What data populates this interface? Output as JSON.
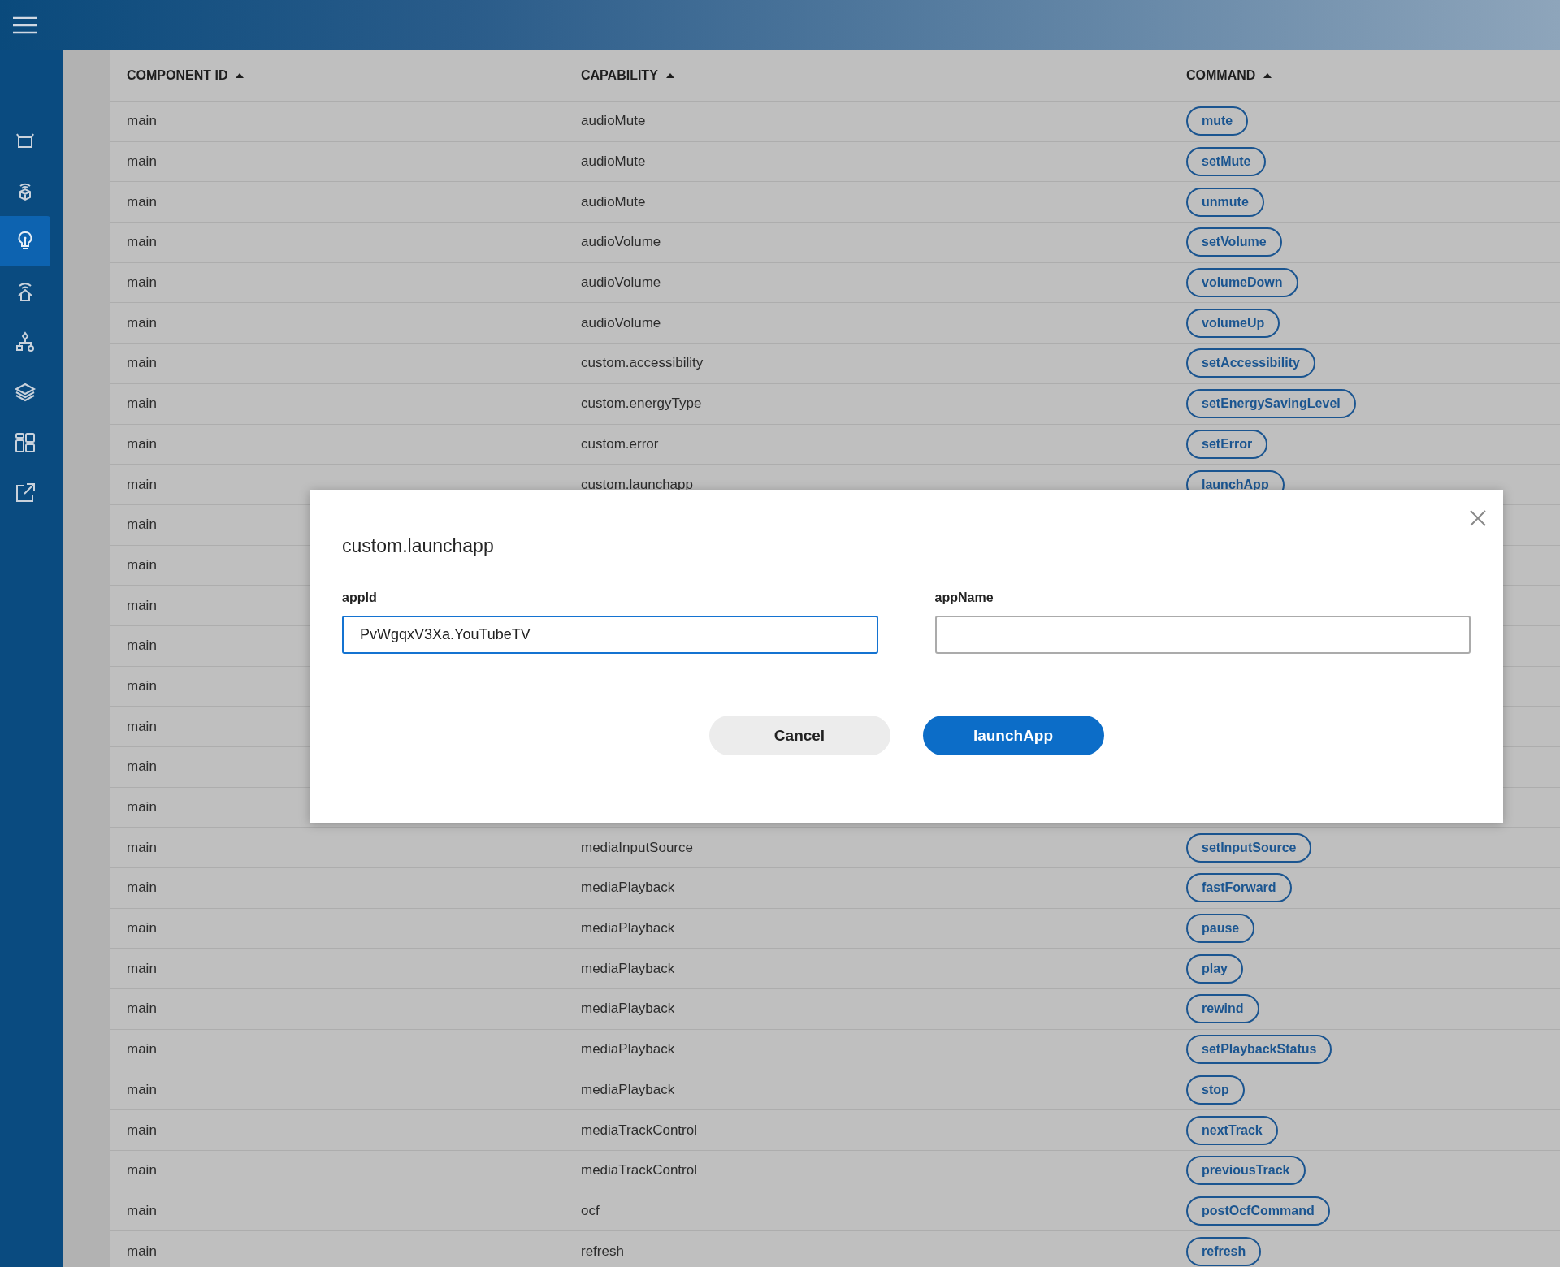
{
  "sidebar": {
    "items": [
      {
        "selected": false
      },
      {
        "selected": false
      },
      {
        "selected": true
      },
      {
        "selected": false
      },
      {
        "selected": false
      },
      {
        "selected": false
      },
      {
        "selected": false
      },
      {
        "selected": false
      }
    ]
  },
  "table": {
    "columns": [
      "COMPONENT ID",
      "CAPABILITY",
      "COMMAND"
    ],
    "rows": [
      {
        "component": "main",
        "capability": "audioMute",
        "command": "mute"
      },
      {
        "component": "main",
        "capability": "audioMute",
        "command": "setMute"
      },
      {
        "component": "main",
        "capability": "audioMute",
        "command": "unmute"
      },
      {
        "component": "main",
        "capability": "audioVolume",
        "command": "setVolume"
      },
      {
        "component": "main",
        "capability": "audioVolume",
        "command": "volumeDown"
      },
      {
        "component": "main",
        "capability": "audioVolume",
        "command": "volumeUp"
      },
      {
        "component": "main",
        "capability": "custom.accessibility",
        "command": "setAccessibility"
      },
      {
        "component": "main",
        "capability": "custom.energyType",
        "command": "setEnergySavingLevel"
      },
      {
        "component": "main",
        "capability": "custom.error",
        "command": "setError"
      },
      {
        "component": "main",
        "capability": "custom.launchapp",
        "command": "launchApp"
      },
      {
        "component": "main"
      },
      {
        "component": "main"
      },
      {
        "component": "main"
      },
      {
        "component": "main"
      },
      {
        "component": "main"
      },
      {
        "component": "main"
      },
      {
        "component": "main"
      },
      {
        "component": "main"
      },
      {
        "component": "main",
        "capability": "mediaInputSource",
        "command": "setInputSource"
      },
      {
        "component": "main",
        "capability": "mediaPlayback",
        "command": "fastForward"
      },
      {
        "component": "main",
        "capability": "mediaPlayback",
        "command": "pause"
      },
      {
        "component": "main",
        "capability": "mediaPlayback",
        "command": "play"
      },
      {
        "component": "main",
        "capability": "mediaPlayback",
        "command": "rewind"
      },
      {
        "component": "main",
        "capability": "mediaPlayback",
        "command": "setPlaybackStatus"
      },
      {
        "component": "main",
        "capability": "mediaPlayback",
        "command": "stop"
      },
      {
        "component": "main",
        "capability": "mediaTrackControl",
        "command": "nextTrack"
      },
      {
        "component": "main",
        "capability": "mediaTrackControl",
        "command": "previousTrack"
      },
      {
        "component": "main",
        "capability": "ocf",
        "command": "postOcfCommand"
      },
      {
        "component": "main",
        "capability": "refresh",
        "command": "refresh"
      }
    ]
  },
  "dialog": {
    "title": "custom.launchapp",
    "fields": [
      {
        "label": "appId",
        "value": "PvWgqxV3Xa.YouTubeTV",
        "focused": true
      },
      {
        "label": "appName",
        "focused": false
      }
    ],
    "buttons": [
      {
        "label": "Cancel",
        "kind": "secondary"
      },
      {
        "label": "launchApp",
        "kind": "primary"
      }
    ]
  }
}
